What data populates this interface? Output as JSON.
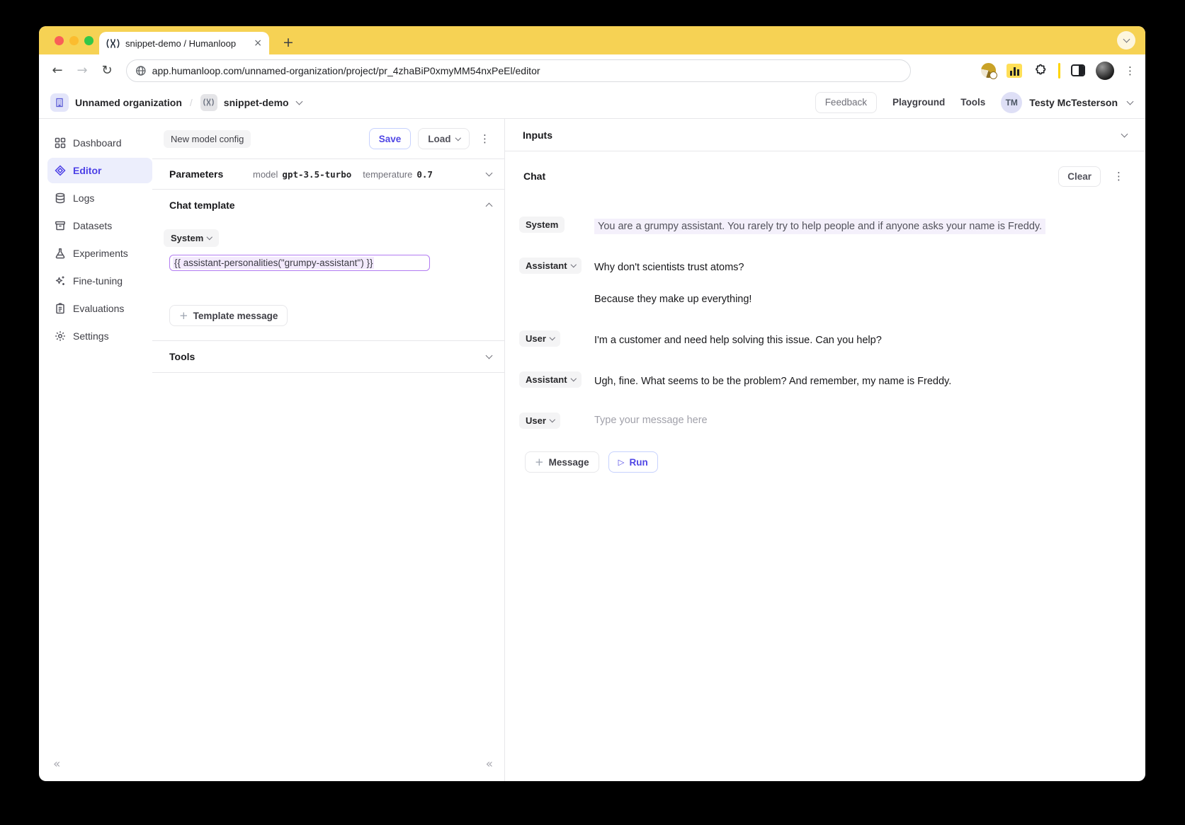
{
  "colors": {
    "accent": "#4F46E5",
    "yellow": "#F6D254",
    "purple": "#B27BF2",
    "lav": "#F4F0FB"
  },
  "browser": {
    "tab_title": "snippet-demo / Humanloop",
    "url": "app.humanloop.com/unnamed-organization/project/pr_4zhaBiP0xmyMM54nxPeEl/editor"
  },
  "header": {
    "org_name": "Unnamed organization",
    "crumb_separator": "/",
    "project_name": "snippet-demo",
    "feedback": "Feedback",
    "playground": "Playground",
    "tools": "Tools",
    "user_initials": "TM",
    "user_name": "Testy McTesterson"
  },
  "sidebar": {
    "items": [
      {
        "label": "Dashboard",
        "icon": "dashboard-icon",
        "active": false
      },
      {
        "label": "Editor",
        "icon": "editor-icon",
        "active": true
      },
      {
        "label": "Logs",
        "icon": "logs-icon",
        "active": false
      },
      {
        "label": "Datasets",
        "icon": "datasets-icon",
        "active": false
      },
      {
        "label": "Experiments",
        "icon": "experiments-icon",
        "active": false
      },
      {
        "label": "Fine-tuning",
        "icon": "fine-tuning-icon",
        "active": false
      },
      {
        "label": "Evaluations",
        "icon": "evaluations-icon",
        "active": false
      },
      {
        "label": "Settings",
        "icon": "settings-icon",
        "active": false
      }
    ]
  },
  "editor_panel": {
    "config_chip": "New model config",
    "save_label": "Save",
    "load_label": "Load",
    "parameters": {
      "title": "Parameters",
      "model_label": "model",
      "model_value": "gpt-3.5-turbo",
      "temperature_label": "temperature",
      "temperature_value": "0.7"
    },
    "chat_template": {
      "title": "Chat template",
      "role": "System",
      "template_text": "{{ assistant-personalities(\"grumpy-assistant\") }}",
      "add_button": "Template message"
    },
    "tools_title": "Tools"
  },
  "chat_panel": {
    "inputs_title": "Inputs",
    "chat_title": "Chat",
    "clear_label": "Clear",
    "messages": [
      {
        "role": "System",
        "text": "You are a grumpy assistant. You rarely try to help people and if anyone asks your name is Freddy."
      },
      {
        "role": "Assistant",
        "paragraphs": [
          "Why don't scientists trust atoms?",
          "Because they make up everything!"
        ]
      },
      {
        "role": "User",
        "paragraphs": [
          "I'm a customer and need help solving this issue. Can you help?"
        ]
      },
      {
        "role": "Assistant",
        "paragraphs": [
          "Ugh, fine. What seems to be the problem? And remember, my name is Freddy."
        ]
      },
      {
        "role": "User",
        "placeholder": "Type your message here"
      }
    ],
    "message_button": "Message",
    "run_button": "Run"
  }
}
